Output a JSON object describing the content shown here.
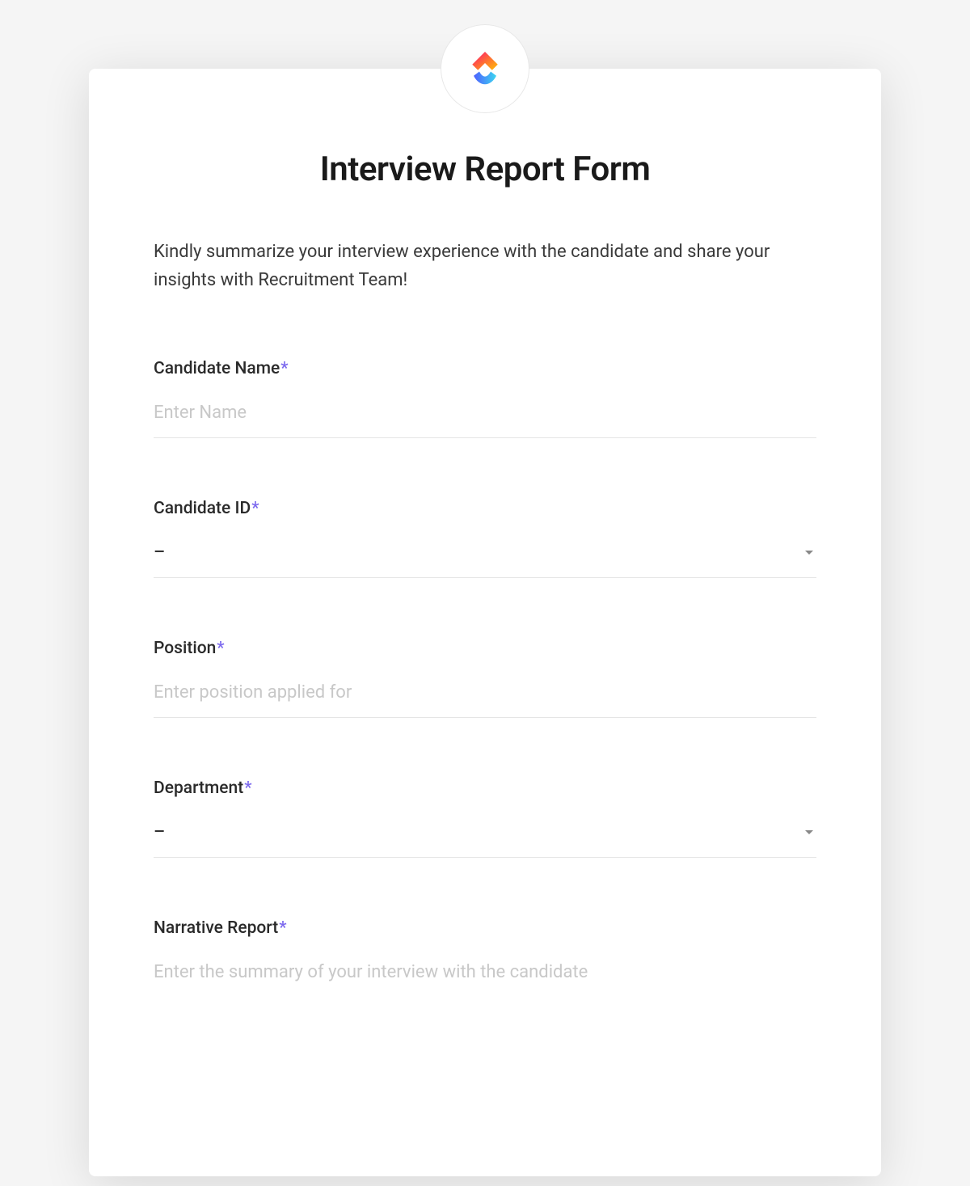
{
  "form": {
    "title": "Interview Report Form",
    "description": "Kindly summarize your interview experience with the candidate and share your insights with Recruitment Team!",
    "required_mark": "*",
    "fields": {
      "candidate_name": {
        "label": "Candidate Name",
        "placeholder": "Enter Name",
        "required": true
      },
      "candidate_id": {
        "label": "Candidate ID",
        "value": "–",
        "required": true
      },
      "position": {
        "label": "Position",
        "placeholder": "Enter position applied for",
        "required": true
      },
      "department": {
        "label": "Department",
        "value": "–",
        "required": true
      },
      "narrative_report": {
        "label": "Narrative Report",
        "placeholder": "Enter the summary of your interview with the candidate",
        "required": true
      }
    }
  },
  "colors": {
    "accent": "#7b68ee"
  }
}
